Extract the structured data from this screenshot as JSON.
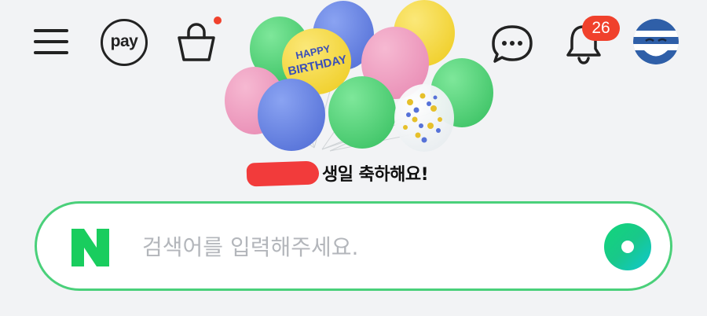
{
  "header": {
    "pay_label": "pay",
    "notification_count": "26",
    "icons": [
      "menu-icon",
      "pay-icon",
      "shopping-bag-icon",
      "chat-icon",
      "bell-icon",
      "avatar"
    ]
  },
  "balloons": {
    "featured_text_line1": "HAPPY",
    "featured_text_line2": "BIRTHDAY"
  },
  "greeting": {
    "text": "생일 축하해요!"
  },
  "search": {
    "placeholder": "검색어를 입력해주세요.",
    "value": ""
  },
  "colors": {
    "accent_green": "#4ad07a",
    "badge_red": "#f0412c",
    "naver_green": "#03c75a"
  }
}
